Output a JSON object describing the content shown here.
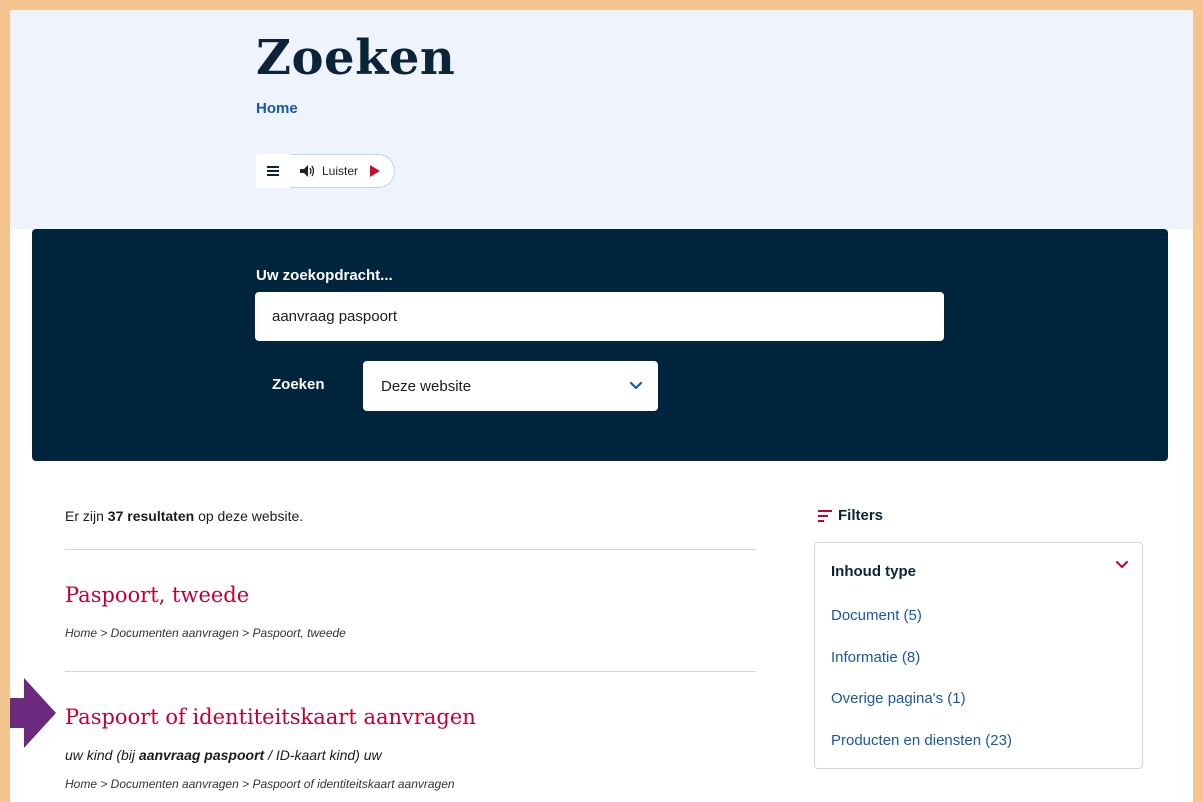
{
  "header": {
    "title": "Zoeken",
    "breadcrumb_home": "Home",
    "listen_label": "Luister"
  },
  "search": {
    "label": "Uw zoekopdracht...",
    "query": "aanvraag paspoort",
    "scope_label": "Zoeken",
    "scope_value": "Deze website"
  },
  "results": {
    "summary_prefix": "Er zijn",
    "summary_count": "37 resultaten",
    "summary_suffix": "op deze website.",
    "items": [
      {
        "title": "Paspoort, tweede",
        "path": "Home > Documenten aanvragen > Paspoort, tweede"
      },
      {
        "title": "Paspoort of identiteitskaart aanvragen",
        "snippet_before": "uw kind (bij",
        "snippet_highlight": "aanvraag paspoort",
        "snippet_after": "/ ID-kaart kind) uw",
        "path": "Home > Documenten aanvragen > Paspoort of identiteitskaart aanvragen"
      }
    ]
  },
  "filters": {
    "heading": "Filters",
    "group_title": "Inhoud type",
    "options": [
      "Document (5)",
      "Informatie (8)",
      "Overige pagina's (1)",
      "Producten en diensten (23)"
    ]
  },
  "colors": {
    "frame": "#f5c58f",
    "hero_bg": "#eef3fc",
    "search_panel": "#01253d",
    "link_blue": "#1758a7",
    "result_red": "#c20033",
    "arrow_purple": "#6b2a7d"
  }
}
